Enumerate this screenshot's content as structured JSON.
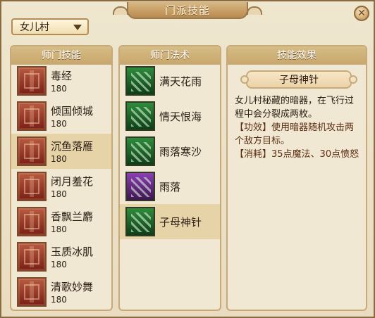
{
  "window": {
    "title": "门派技能",
    "close_label": "✕"
  },
  "school_select": {
    "value": "女儿村"
  },
  "panels": {
    "master_skills": {
      "header": "师门技能",
      "items": [
        {
          "name": "毒经",
          "level": "180"
        },
        {
          "name": "倾国倾城",
          "level": "180"
        },
        {
          "name": "沉鱼落雁",
          "level": "180"
        },
        {
          "name": "闭月羞花",
          "level": "180"
        },
        {
          "name": "香飘兰麝",
          "level": "180"
        },
        {
          "name": "玉质冰肌",
          "level": "180"
        },
        {
          "name": "清歌妙舞",
          "level": "180"
        }
      ],
      "selected_index": 2
    },
    "master_spells": {
      "header": "师门法术",
      "items": [
        {
          "name": "满天花雨",
          "icon": "leaves-icon"
        },
        {
          "name": "情天恨海",
          "icon": "sword-icon"
        },
        {
          "name": "雨落寒沙",
          "icon": "needles-icon"
        },
        {
          "name": "雨落",
          "icon": "needles-icon"
        },
        {
          "name": "子母神针",
          "icon": "needle-icon"
        }
      ],
      "selected_index": 4
    },
    "skill_effect": {
      "header": "技能效果",
      "selected_name": "子母神针",
      "desc_line1": "女儿村秘藏的暗器，在飞行过程中会分裂成两枚。",
      "desc_line2": "【功效】使用暗器随机攻击两个敌方目标。",
      "desc_line3": "【消耗】35点魔法、30点愤怒"
    }
  },
  "colors": {
    "frame": "#8a6a3f",
    "panel_bg": "#f1e8d3",
    "header_bg": "#c9a86e",
    "selected_row": "#e7d3a8",
    "skill_icon_red": "#7a1f15",
    "spell_icon_green": "#0f3d17",
    "spell_icon_purple": "#3c1650"
  }
}
